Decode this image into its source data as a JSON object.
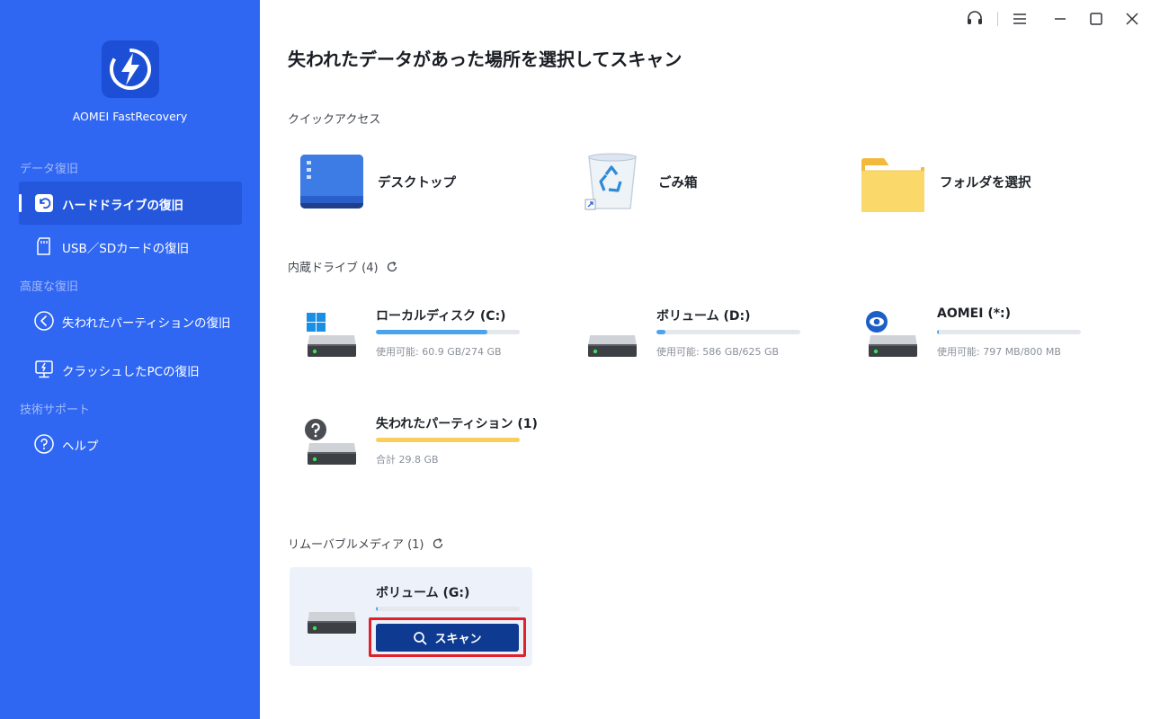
{
  "app": {
    "name": "AOMEI FastRecovery",
    "brand_color": "#2f66f2",
    "logo_icon": "lightning-bolt-icon"
  },
  "sidebar": {
    "sections": [
      {
        "label": "データ復旧",
        "items": [
          {
            "label": "ハードドライブの復旧",
            "icon": "hard-drive-restore-icon",
            "active": true
          },
          {
            "label": "USB／SDカードの復旧",
            "icon": "sd-card-icon",
            "active": false
          }
        ]
      },
      {
        "label": "高度な復旧",
        "items": [
          {
            "label": "失われたパーティションの復旧",
            "icon": "partition-restore-icon",
            "active": false
          },
          {
            "label": "クラッシュしたPCの復旧",
            "icon": "crashed-pc-icon",
            "active": false
          }
        ]
      },
      {
        "label": "技術サポート",
        "items": [
          {
            "label": "ヘルプ",
            "icon": "help-icon",
            "active": false
          }
        ]
      }
    ]
  },
  "titlebar": {
    "icons": [
      "headset-icon",
      "menu-icon",
      "minimize-icon",
      "maximize-icon",
      "close-icon"
    ]
  },
  "main": {
    "title": "失われたデータがあった場所を選択してスキャン",
    "quick_access": {
      "label": "クイックアクセス",
      "items": [
        {
          "label": "デスクトップ",
          "icon": "desktop-icon"
        },
        {
          "label": "ごみ箱",
          "icon": "recycle-bin-icon"
        },
        {
          "label": "フォルダを選択",
          "icon": "folder-icon"
        }
      ]
    },
    "internal_drives": {
      "label": "内蔵ドライブ (4)",
      "drives": [
        {
          "name": "ローカルディスク (C:)",
          "info": "使用可能: 60.9 GB/274 GB",
          "fill": 0.778,
          "bar_color": "#4aa3ee",
          "badge": "windows-logo-icon"
        },
        {
          "name": "ボリューム (D:)",
          "info": "使用可能: 586 GB/625 GB",
          "fill": 0.062,
          "bar_color": "#4aa3ee",
          "badge": ""
        },
        {
          "name": "AOMEI (*:)",
          "info": "使用可能: 797 MB/800 MB",
          "fill": 0.004,
          "bar_color": "#4aa3ee",
          "badge": "eye-icon"
        },
        {
          "name": "失われたパーティション (1)",
          "info": "合計 29.8 GB",
          "fill": 1.0,
          "bar_color": "#f7cf5a",
          "badge": "question-icon"
        }
      ]
    },
    "removable": {
      "label": "リムーバブルメディア (1)",
      "drives": [
        {
          "name": "ボリューム (G:)",
          "fill": 0.01,
          "bar_color": "#4aa3ee",
          "scan_label": "スキャン"
        }
      ]
    }
  }
}
